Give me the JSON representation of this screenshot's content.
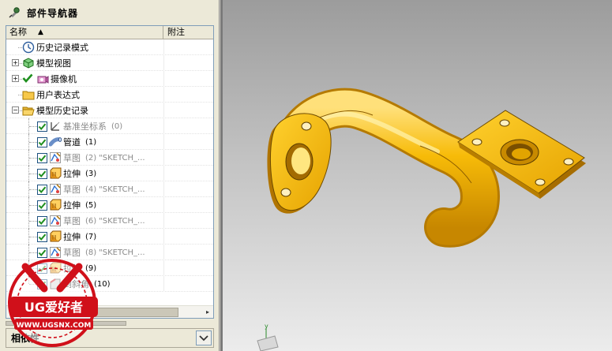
{
  "navigator": {
    "title": "部件导航器",
    "columns": {
      "name": "名称",
      "note": "附注"
    },
    "rows": [
      {
        "label": "历史记录模式",
        "num": "",
        "q": "",
        "dim": false,
        "icon": "clock-icon",
        "checkbox": false,
        "level": 0,
        "expander": ""
      },
      {
        "label": "模型视图",
        "num": "",
        "q": "",
        "dim": false,
        "icon": "model-view-icon",
        "checkbox": false,
        "level": 0,
        "expander": "+"
      },
      {
        "label": "摄像机",
        "num": "",
        "q": "",
        "dim": false,
        "icon": "camera-icon",
        "checkbox": false,
        "level": 0,
        "expander": "+"
      },
      {
        "label": "用户表达式",
        "num": "",
        "q": "",
        "dim": false,
        "icon": "folder-icon",
        "checkbox": false,
        "level": 0,
        "expander": ""
      },
      {
        "label": "模型历史记录",
        "num": "",
        "q": "",
        "dim": false,
        "icon": "open-folder-icon",
        "checkbox": false,
        "level": 0,
        "expander": "−"
      },
      {
        "label": "基准坐标系",
        "num": "(0)",
        "q": "",
        "dim": true,
        "icon": "datum-csys-icon",
        "checkbox": true,
        "level": 1,
        "expander": ""
      },
      {
        "label": "管道",
        "num": "(1)",
        "q": "",
        "dim": false,
        "icon": "tube-icon",
        "checkbox": true,
        "level": 1,
        "expander": ""
      },
      {
        "label": "草图",
        "num": "(2)",
        "q": "\"SKETCH_...",
        "dim": true,
        "icon": "sketch-icon",
        "checkbox": true,
        "level": 1,
        "expander": ""
      },
      {
        "label": "拉伸",
        "num": "(3)",
        "q": "",
        "dim": false,
        "icon": "extrude-icon",
        "checkbox": true,
        "level": 1,
        "expander": ""
      },
      {
        "label": "草图",
        "num": "(4)",
        "q": "\"SKETCH_...",
        "dim": true,
        "icon": "sketch-icon",
        "checkbox": true,
        "level": 1,
        "expander": ""
      },
      {
        "label": "拉伸",
        "num": "(5)",
        "q": "",
        "dim": false,
        "icon": "extrude-icon",
        "checkbox": true,
        "level": 1,
        "expander": ""
      },
      {
        "label": "草图",
        "num": "(6)",
        "q": "\"SKETCH_...",
        "dim": true,
        "icon": "sketch-icon",
        "checkbox": true,
        "level": 1,
        "expander": ""
      },
      {
        "label": "拉伸",
        "num": "(7)",
        "q": "",
        "dim": false,
        "icon": "extrude-icon",
        "checkbox": true,
        "level": 1,
        "expander": ""
      },
      {
        "label": "草图",
        "num": "(8)",
        "q": "\"SKETCH_...",
        "dim": true,
        "icon": "sketch-icon",
        "checkbox": true,
        "level": 1,
        "expander": ""
      },
      {
        "label": "拉伸",
        "num": "(9)",
        "q": "",
        "dim": false,
        "icon": "extrude-icon",
        "checkbox": true,
        "level": 1,
        "expander": ""
      },
      {
        "label": "倒斜角",
        "num": "(10)",
        "q": "",
        "dim": false,
        "icon": "chamfer-icon",
        "checkbox": true,
        "level": 1,
        "expander": ""
      }
    ]
  },
  "dependency_panel": {
    "title": "相依性"
  },
  "watermark": {
    "brand": "UG爱好者",
    "url": "WWW.UGSNX.COM"
  },
  "colors": {
    "part": "#f5b800",
    "part_shadow": "#c88400",
    "check": "#1f8f1f"
  }
}
